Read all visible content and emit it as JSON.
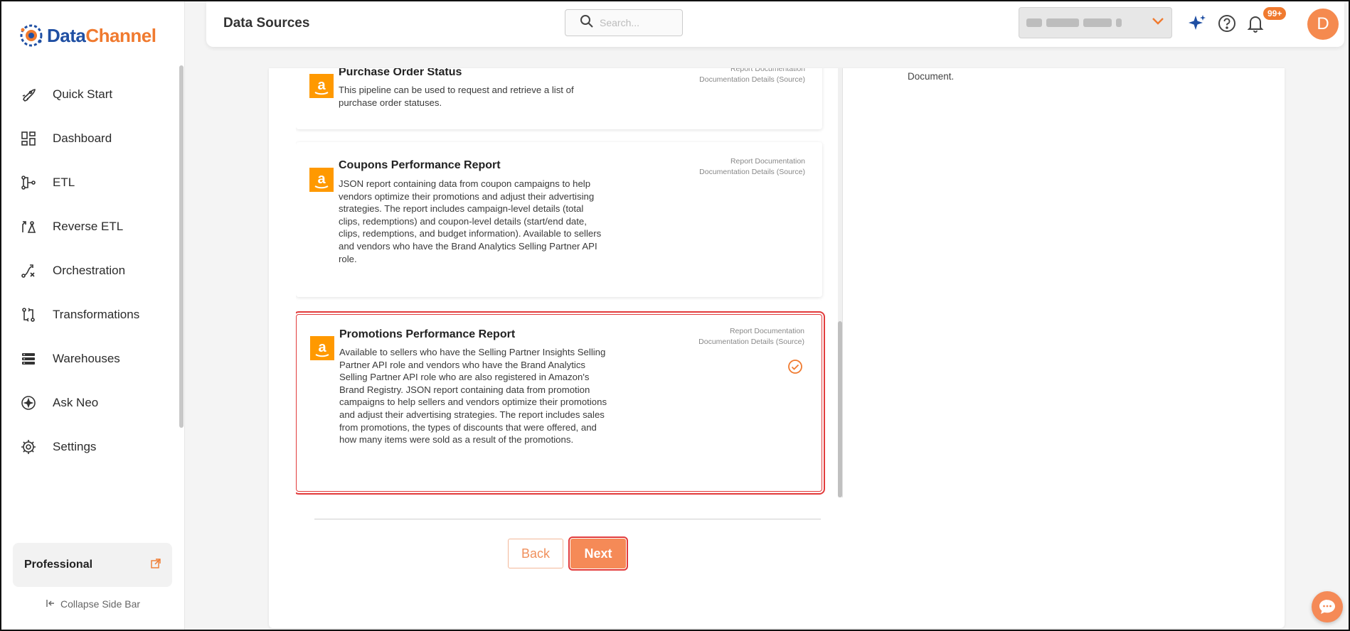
{
  "brand": {
    "name_part1": "Data",
    "name_part2": "Channel",
    "colors": {
      "blue": "#1f4fa3",
      "orange": "#f07a2f"
    }
  },
  "sidebar": {
    "items": [
      {
        "label": "Quick Start",
        "icon": "rocket-icon"
      },
      {
        "label": "Dashboard",
        "icon": "dashboard-icon"
      },
      {
        "label": "ETL",
        "icon": "etl-icon"
      },
      {
        "label": "Reverse ETL",
        "icon": "reverse-etl-icon"
      },
      {
        "label": "Orchestration",
        "icon": "orchestration-icon"
      },
      {
        "label": "Transformations",
        "icon": "transformations-icon"
      },
      {
        "label": "Warehouses",
        "icon": "warehouses-icon"
      },
      {
        "label": "Ask Neo",
        "icon": "ask-neo-icon"
      },
      {
        "label": "Settings",
        "icon": "gear-icon"
      }
    ],
    "plan": "Professional",
    "collapse_label": "Collapse Side Bar"
  },
  "header": {
    "title": "Data Sources",
    "search_placeholder": "Search...",
    "notification_count": "99+",
    "avatar_initial": "D"
  },
  "reports": [
    {
      "title": "Purchase Order Status",
      "description": "This pipeline can be used to request and retrieve a list of purchase order statuses.",
      "link1": "Report Documentation",
      "link2": "Documentation Details (Source)",
      "selected": false
    },
    {
      "title": "Coupons Performance Report",
      "description": "JSON report containing data from coupon campaigns to help vendors optimize their promotions and adjust their advertising strategies. The report includes campaign-level details (total clips, redemptions) and coupon-level details (start/end date, clips, redemptions, and budget information). Available to sellers and vendors who have the Brand Analytics Selling Partner API role.",
      "link1": "Report Documentation",
      "link2": "Documentation Details (Source)",
      "selected": false
    },
    {
      "title": "Promotions Performance Report",
      "description": "Available to sellers who have the Selling Partner Insights Selling Partner API role and vendors who have the Brand Analytics Selling Partner API role who are also registered in Amazon's Brand Registry. JSON report containing data from promotion campaigns to help sellers and vendors optimize their promotions and adjust their advertising strategies. The report includes sales from promotions, the types of discounts that were offered, and how many items were sold as a result of the promotions.",
      "link1": "Report Documentation",
      "link2": "Documentation Details (Source)",
      "selected": true
    }
  ],
  "right_panel_text": "Document.",
  "buttons": {
    "back": "Back",
    "next": "Next"
  }
}
